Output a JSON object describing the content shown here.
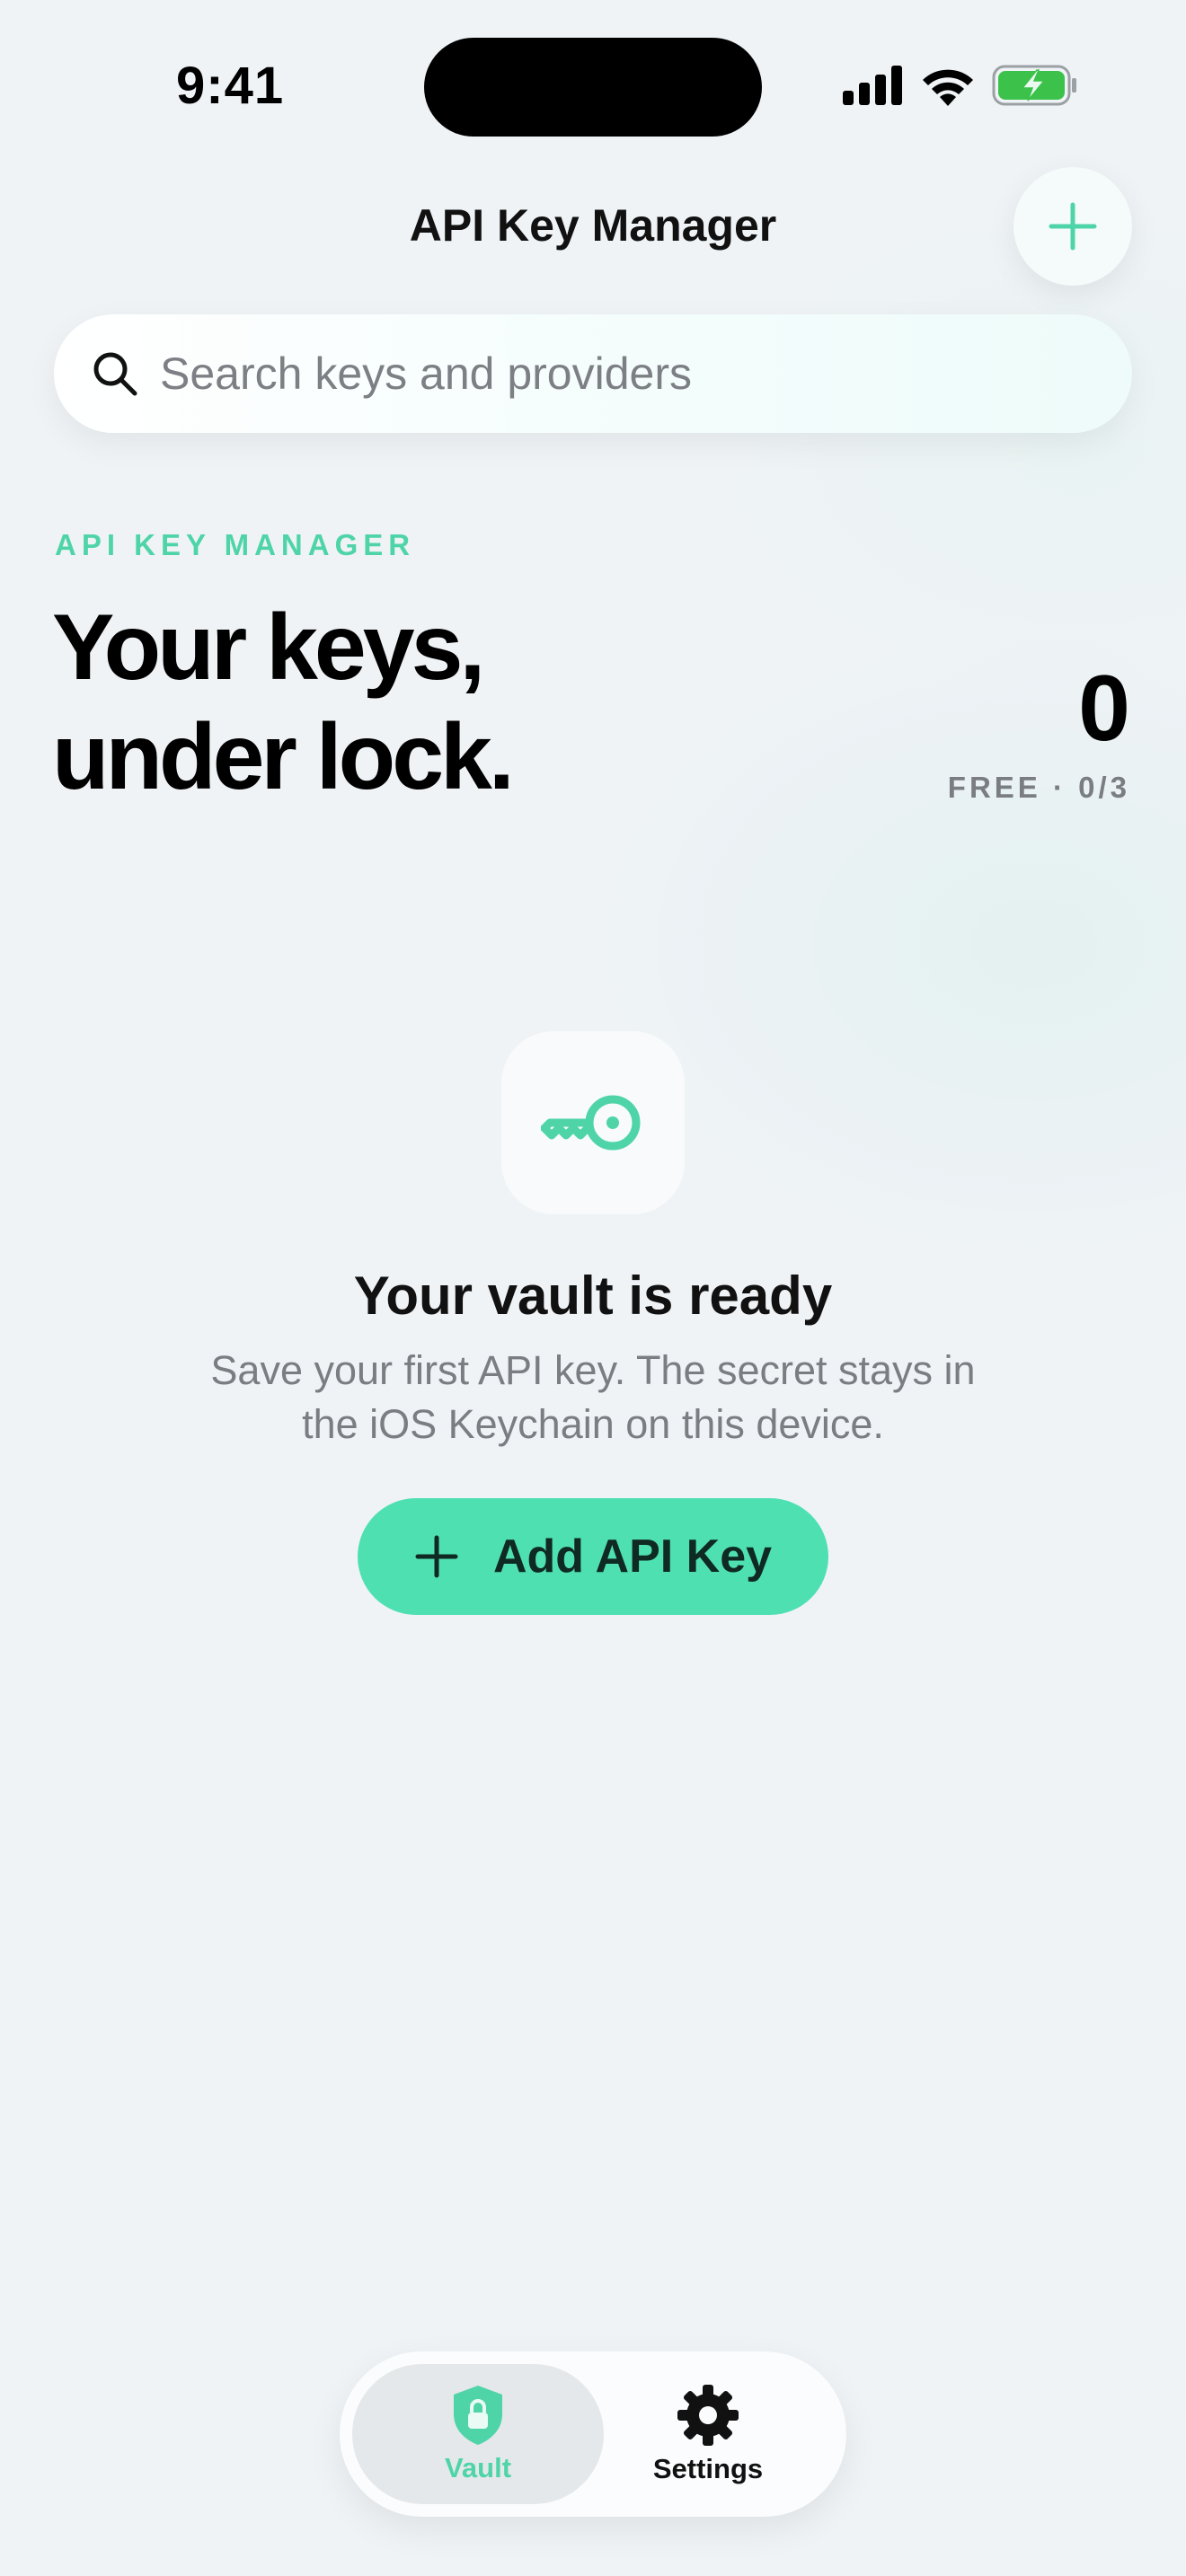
{
  "status_bar": {
    "time": "9:41"
  },
  "nav": {
    "title": "API Key Manager"
  },
  "search": {
    "placeholder": "Search keys and providers",
    "value": ""
  },
  "hero": {
    "eyebrow": "API KEY MANAGER",
    "title_line1": "Your keys,",
    "title_line2": "under lock.",
    "key_count": "0",
    "plan_label": "FREE · 0/3"
  },
  "empty_state": {
    "title": "Your vault is ready",
    "description": "Save your first API key. The secret stays in the iOS Keychain on this device.",
    "button_label": "Add API Key"
  },
  "tab_bar": {
    "tabs": [
      {
        "label": "Vault",
        "icon": "shield-lock-icon",
        "active": true
      },
      {
        "label": "Settings",
        "icon": "gear-icon",
        "active": false
      }
    ]
  },
  "colors": {
    "accent": "#4fe0b2",
    "accent_text": "#4fd4a8",
    "background": "#eff3f6",
    "battery": "#3cc24a"
  }
}
